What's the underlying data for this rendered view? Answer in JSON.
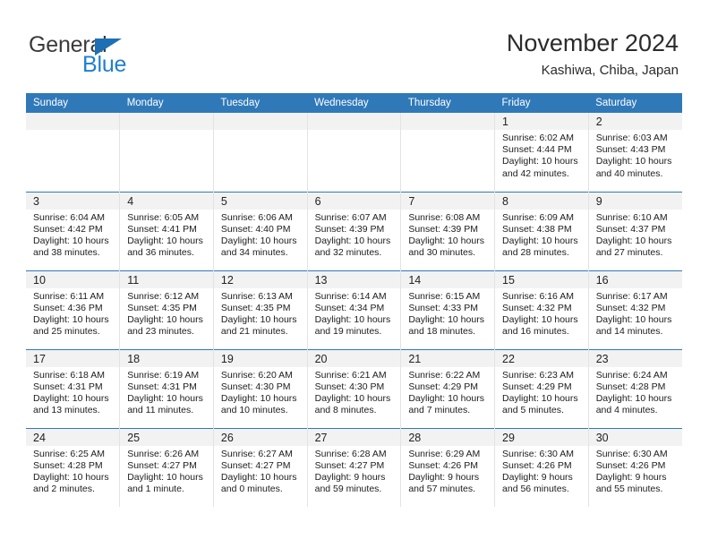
{
  "brand": {
    "name_part1": "General",
    "name_part2": "Blue"
  },
  "header": {
    "title": "November 2024",
    "subtitle": "Kashiwa, Chiba, Japan"
  },
  "colors": {
    "header_blue": "#3079b8",
    "brand_blue": "#1f7fd0",
    "daynum_band": "#f2f2f2"
  },
  "weekday_headers": [
    "Sunday",
    "Monday",
    "Tuesday",
    "Wednesday",
    "Thursday",
    "Friday",
    "Saturday"
  ],
  "weeks": [
    [
      {
        "day": "",
        "blank": true
      },
      {
        "day": "",
        "blank": true
      },
      {
        "day": "",
        "blank": true
      },
      {
        "day": "",
        "blank": true
      },
      {
        "day": "",
        "blank": true
      },
      {
        "day": "1",
        "sunrise": "Sunrise: 6:02 AM",
        "sunset": "Sunset: 4:44 PM",
        "daylight": "Daylight: 10 hours and 42 minutes."
      },
      {
        "day": "2",
        "sunrise": "Sunrise: 6:03 AM",
        "sunset": "Sunset: 4:43 PM",
        "daylight": "Daylight: 10 hours and 40 minutes."
      }
    ],
    [
      {
        "day": "3",
        "sunrise": "Sunrise: 6:04 AM",
        "sunset": "Sunset: 4:42 PM",
        "daylight": "Daylight: 10 hours and 38 minutes."
      },
      {
        "day": "4",
        "sunrise": "Sunrise: 6:05 AM",
        "sunset": "Sunset: 4:41 PM",
        "daylight": "Daylight: 10 hours and 36 minutes."
      },
      {
        "day": "5",
        "sunrise": "Sunrise: 6:06 AM",
        "sunset": "Sunset: 4:40 PM",
        "daylight": "Daylight: 10 hours and 34 minutes."
      },
      {
        "day": "6",
        "sunrise": "Sunrise: 6:07 AM",
        "sunset": "Sunset: 4:39 PM",
        "daylight": "Daylight: 10 hours and 32 minutes."
      },
      {
        "day": "7",
        "sunrise": "Sunrise: 6:08 AM",
        "sunset": "Sunset: 4:39 PM",
        "daylight": "Daylight: 10 hours and 30 minutes."
      },
      {
        "day": "8",
        "sunrise": "Sunrise: 6:09 AM",
        "sunset": "Sunset: 4:38 PM",
        "daylight": "Daylight: 10 hours and 28 minutes."
      },
      {
        "day": "9",
        "sunrise": "Sunrise: 6:10 AM",
        "sunset": "Sunset: 4:37 PM",
        "daylight": "Daylight: 10 hours and 27 minutes."
      }
    ],
    [
      {
        "day": "10",
        "sunrise": "Sunrise: 6:11 AM",
        "sunset": "Sunset: 4:36 PM",
        "daylight": "Daylight: 10 hours and 25 minutes."
      },
      {
        "day": "11",
        "sunrise": "Sunrise: 6:12 AM",
        "sunset": "Sunset: 4:35 PM",
        "daylight": "Daylight: 10 hours and 23 minutes."
      },
      {
        "day": "12",
        "sunrise": "Sunrise: 6:13 AM",
        "sunset": "Sunset: 4:35 PM",
        "daylight": "Daylight: 10 hours and 21 minutes."
      },
      {
        "day": "13",
        "sunrise": "Sunrise: 6:14 AM",
        "sunset": "Sunset: 4:34 PM",
        "daylight": "Daylight: 10 hours and 19 minutes."
      },
      {
        "day": "14",
        "sunrise": "Sunrise: 6:15 AM",
        "sunset": "Sunset: 4:33 PM",
        "daylight": "Daylight: 10 hours and 18 minutes."
      },
      {
        "day": "15",
        "sunrise": "Sunrise: 6:16 AM",
        "sunset": "Sunset: 4:32 PM",
        "daylight": "Daylight: 10 hours and 16 minutes."
      },
      {
        "day": "16",
        "sunrise": "Sunrise: 6:17 AM",
        "sunset": "Sunset: 4:32 PM",
        "daylight": "Daylight: 10 hours and 14 minutes."
      }
    ],
    [
      {
        "day": "17",
        "sunrise": "Sunrise: 6:18 AM",
        "sunset": "Sunset: 4:31 PM",
        "daylight": "Daylight: 10 hours and 13 minutes."
      },
      {
        "day": "18",
        "sunrise": "Sunrise: 6:19 AM",
        "sunset": "Sunset: 4:31 PM",
        "daylight": "Daylight: 10 hours and 11 minutes."
      },
      {
        "day": "19",
        "sunrise": "Sunrise: 6:20 AM",
        "sunset": "Sunset: 4:30 PM",
        "daylight": "Daylight: 10 hours and 10 minutes."
      },
      {
        "day": "20",
        "sunrise": "Sunrise: 6:21 AM",
        "sunset": "Sunset: 4:30 PM",
        "daylight": "Daylight: 10 hours and 8 minutes."
      },
      {
        "day": "21",
        "sunrise": "Sunrise: 6:22 AM",
        "sunset": "Sunset: 4:29 PM",
        "daylight": "Daylight: 10 hours and 7 minutes."
      },
      {
        "day": "22",
        "sunrise": "Sunrise: 6:23 AM",
        "sunset": "Sunset: 4:29 PM",
        "daylight": "Daylight: 10 hours and 5 minutes."
      },
      {
        "day": "23",
        "sunrise": "Sunrise: 6:24 AM",
        "sunset": "Sunset: 4:28 PM",
        "daylight": "Daylight: 10 hours and 4 minutes."
      }
    ],
    [
      {
        "day": "24",
        "sunrise": "Sunrise: 6:25 AM",
        "sunset": "Sunset: 4:28 PM",
        "daylight": "Daylight: 10 hours and 2 minutes."
      },
      {
        "day": "25",
        "sunrise": "Sunrise: 6:26 AM",
        "sunset": "Sunset: 4:27 PM",
        "daylight": "Daylight: 10 hours and 1 minute."
      },
      {
        "day": "26",
        "sunrise": "Sunrise: 6:27 AM",
        "sunset": "Sunset: 4:27 PM",
        "daylight": "Daylight: 10 hours and 0 minutes."
      },
      {
        "day": "27",
        "sunrise": "Sunrise: 6:28 AM",
        "sunset": "Sunset: 4:27 PM",
        "daylight": "Daylight: 9 hours and 59 minutes."
      },
      {
        "day": "28",
        "sunrise": "Sunrise: 6:29 AM",
        "sunset": "Sunset: 4:26 PM",
        "daylight": "Daylight: 9 hours and 57 minutes."
      },
      {
        "day": "29",
        "sunrise": "Sunrise: 6:30 AM",
        "sunset": "Sunset: 4:26 PM",
        "daylight": "Daylight: 9 hours and 56 minutes."
      },
      {
        "day": "30",
        "sunrise": "Sunrise: 6:30 AM",
        "sunset": "Sunset: 4:26 PM",
        "daylight": "Daylight: 9 hours and 55 minutes."
      }
    ]
  ]
}
